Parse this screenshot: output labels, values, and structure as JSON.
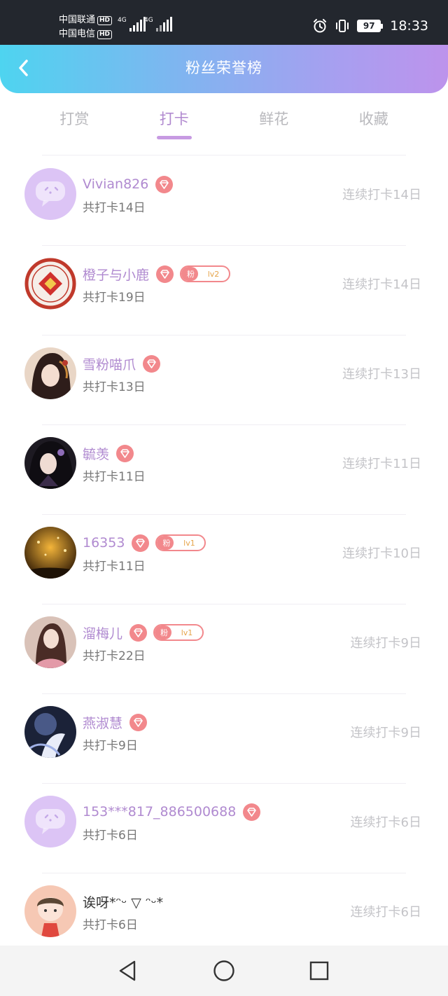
{
  "status_bar": {
    "carrier_1": "中国联通",
    "carrier_2": "中国电信",
    "hd_badge": "HD",
    "network": "4G",
    "battery": "97",
    "time": "18:33"
  },
  "header": {
    "title": "粉丝荣誉榜",
    "gradient": [
      "#4ed4f0",
      "#bd93ec"
    ]
  },
  "tabs": [
    {
      "label": "打赏",
      "active": false
    },
    {
      "label": "打卡",
      "active": true
    },
    {
      "label": "鲜花",
      "active": false
    },
    {
      "label": "收藏",
      "active": false
    }
  ],
  "fans": [
    {
      "name": "Vivian826",
      "total": "共打卡14日",
      "streak": "连续打卡14日",
      "avatar": "default-chat-avatar",
      "fan_badge": null
    },
    {
      "name": "橙子与小鹿",
      "total": "共打卡19日",
      "streak": "连续打卡14日",
      "avatar": "red-seal-avatar",
      "fan_badge": {
        "label": "粉",
        "level": "lv2"
      }
    },
    {
      "name": "雪粉喵爪",
      "total": "共打卡13日",
      "streak": "连续打卡13日",
      "avatar": "illustrated-woman-avatar",
      "fan_badge": null
    },
    {
      "name": "毓羡",
      "total": "共打卡11日",
      "streak": "连续打卡11日",
      "avatar": "dark-haired-woman-avatar",
      "fan_badge": null
    },
    {
      "name": "16353",
      "total": "共打卡11日",
      "streak": "连续打卡10日",
      "avatar": "golden-night-avatar",
      "fan_badge": {
        "label": "粉",
        "level": "lv1"
      }
    },
    {
      "name": "溜梅儿",
      "total": "共打卡22日",
      "streak": "连续打卡9日",
      "avatar": "pink-dress-woman-avatar",
      "fan_badge": {
        "label": "粉",
        "level": "lv1"
      }
    },
    {
      "name": "燕淑慧",
      "total": "共打卡9日",
      "streak": "连续打卡9日",
      "avatar": "blue-fantasy-avatar",
      "fan_badge": null
    },
    {
      "name": "153***817_886500688",
      "total": "共打卡6日",
      "streak": "连续打卡6日",
      "avatar": "default-chat-avatar",
      "fan_badge": null
    },
    {
      "name": "诶呀*ᵔᵕ ▽ ᵔᵕ*",
      "total": "共打卡6日",
      "streak": "连续打卡6日",
      "avatar": "cartoon-boy-avatar",
      "fan_badge": null
    }
  ],
  "colors": {
    "accent_purple": "#b08ad0",
    "badge_pink": "#f2888c",
    "muted_text": "#c4c4c8"
  },
  "nav": {
    "back": "back-triangle-icon",
    "home": "home-circle-icon",
    "recent": "recents-square-icon"
  }
}
